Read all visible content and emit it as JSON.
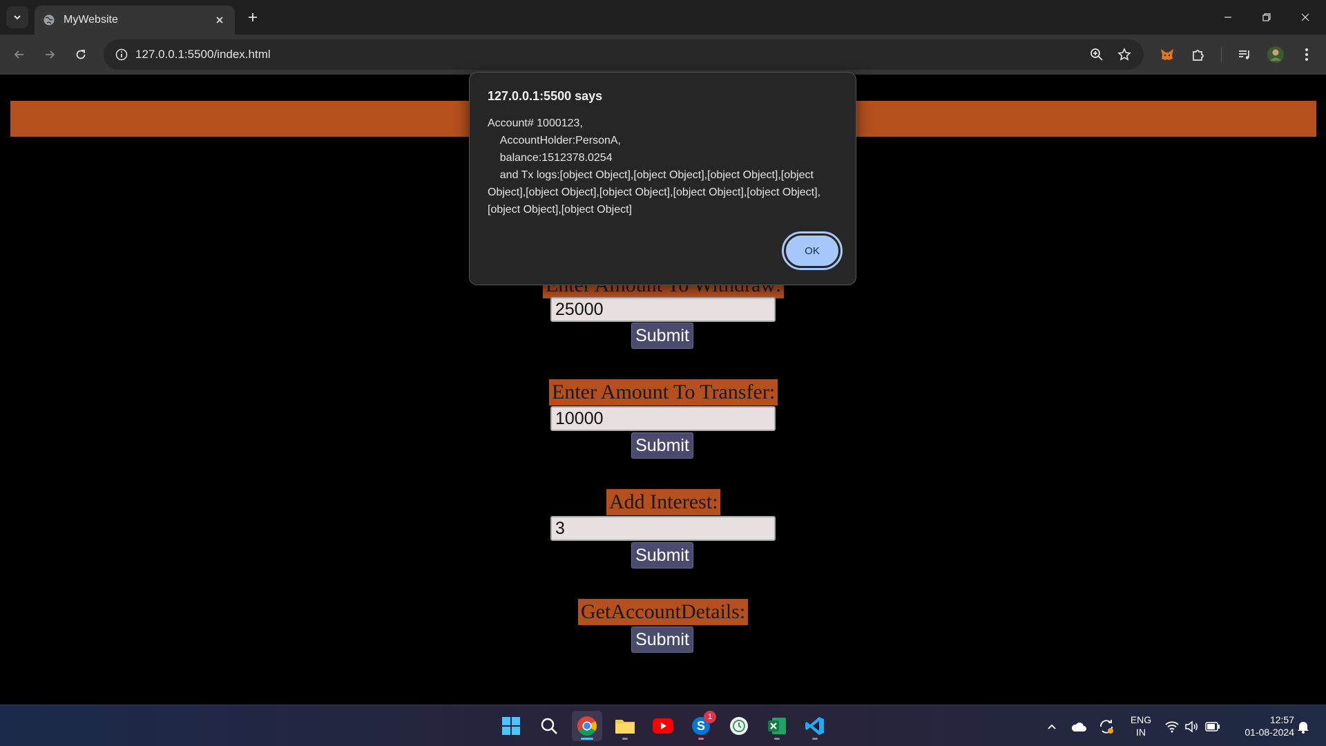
{
  "browser": {
    "tab_title": "MyWebsite",
    "url": "127.0.0.1:5500/index.html"
  },
  "page": {
    "withdraw": {
      "label": "Enter Amount To Withdraw:",
      "value": "25000",
      "submit_label": "Submit"
    },
    "transfer": {
      "label": "Enter Amount To Transfer:",
      "value": "10000",
      "submit_label": "Submit"
    },
    "interest": {
      "label": "Add Interest:",
      "value": "3",
      "submit_label": "Submit"
    },
    "details": {
      "label": "GetAccountDetails:",
      "submit_label": "Submit"
    }
  },
  "dialog": {
    "title": "127.0.0.1:5500 says",
    "message": "Account# 1000123,\n    AccountHolder:PersonA,\n    balance:1512378.0254\n    and Tx logs:[object Object],[object Object],[object Object],[object Object],[object Object],[object Object],[object Object],[object Object],[object Object],[object Object]",
    "ok_label": "OK"
  },
  "taskbar": {
    "skype_badge": "1",
    "language": "ENG",
    "region": "IN",
    "time": "12:57",
    "date": "01-08-2024"
  },
  "colors": {
    "accent_orange": "#b5501e",
    "submit_bg": "#4a4a6e",
    "dialog_ok": "#a8c7fa"
  }
}
